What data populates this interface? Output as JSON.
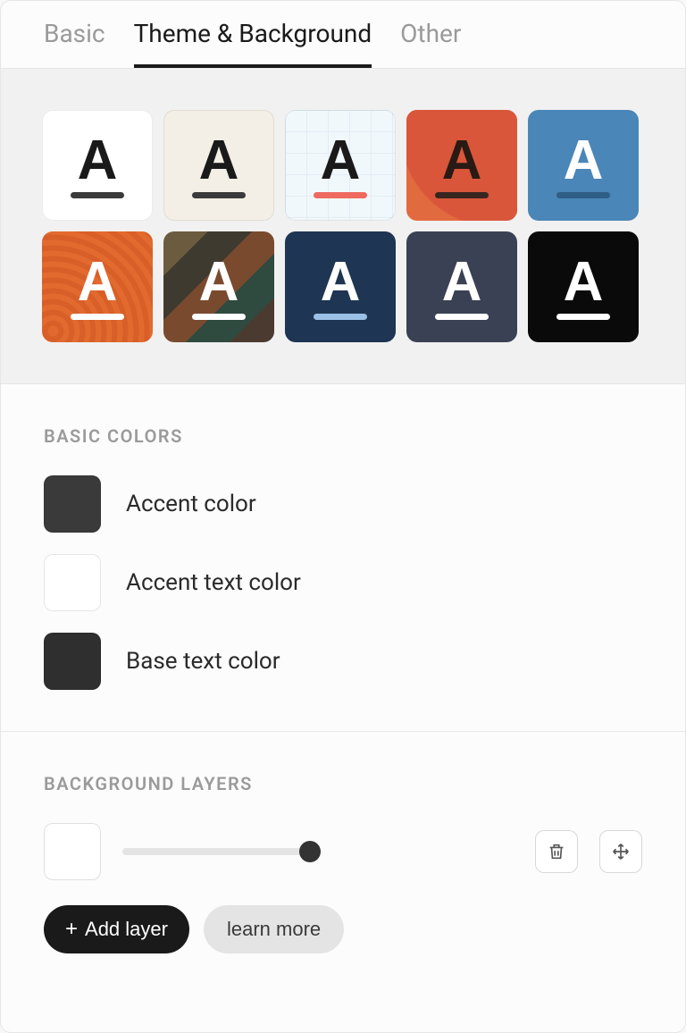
{
  "tabs": [
    {
      "label": "Basic",
      "active": false
    },
    {
      "label": "Theme & Background",
      "active": true
    },
    {
      "label": "Other",
      "active": false
    }
  ],
  "themes": [
    {
      "bg": "#ffffff",
      "glyph_color": "#1a1a1a",
      "underline": "#3a3a3a",
      "border": true
    },
    {
      "bg": "#f3efe6",
      "glyph_color": "#1a1a1a",
      "underline": "#3a3a3a",
      "border": true
    },
    {
      "bg_class": "sw4-grid",
      "glyph_color": "#1a1a1a",
      "underline": "#ee6a5f",
      "border": true
    },
    {
      "bg": "#e26a3f",
      "bg_class": "sw5-bg",
      "glyph_color": "#2a1a14",
      "underline": "#3a2620"
    },
    {
      "bg": "#4a86b8",
      "glyph_color": "#ffffff",
      "underline": "#2f5e86"
    },
    {
      "bg_class": "sw7-bg",
      "glyph_color": "#ffffff",
      "underline": "#ffffff"
    },
    {
      "bg_class": "sw8-bg",
      "glyph_color": "#ffffff",
      "underline": "#ffffff"
    },
    {
      "bg": "#1e3553",
      "glyph_color": "#ffffff",
      "underline": "#9bc0e6"
    },
    {
      "bg": "#3a4154",
      "glyph_color": "#ffffff",
      "underline": "#ffffff"
    },
    {
      "bg": "#0a0a0a",
      "glyph_color": "#ffffff",
      "underline": "#ffffff"
    }
  ],
  "basic_colors": {
    "title": "BASIC COLORS",
    "items": [
      {
        "label": "Accent color",
        "color": "#3a3a3a"
      },
      {
        "label": "Accent text color",
        "color": "#ffffff"
      },
      {
        "label": "Base text color",
        "color": "#2f2f2f"
      }
    ]
  },
  "background_layers": {
    "title": "BACKGROUND LAYERS",
    "layer_color": "#ffffff",
    "slider_value_pct": 100,
    "add_layer_label": "Add layer",
    "learn_more_label": "learn more"
  }
}
